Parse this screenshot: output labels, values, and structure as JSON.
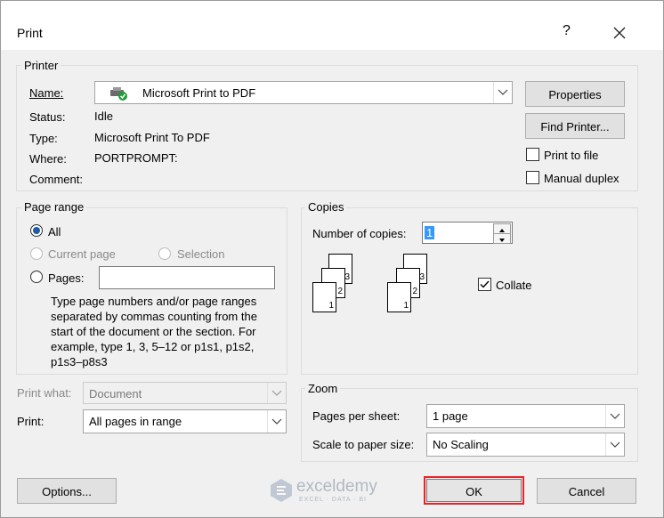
{
  "window": {
    "title": "Print",
    "help": "?",
    "close_icon": "close-icon"
  },
  "printer": {
    "legend": "Printer",
    "name_label": "Name:",
    "name_value": "Microsoft Print to PDF",
    "printer_icon": "printer-ready-icon",
    "status_label": "Status:",
    "status_value": "Idle",
    "type_label": "Type:",
    "type_value": "Microsoft Print To PDF",
    "where_label": "Where:",
    "where_value": "PORTPROMPT:",
    "comment_label": "Comment:",
    "comment_value": "",
    "properties_button": "Properties",
    "find_printer_button": "Find Printer...",
    "print_to_file_label": "Print to file",
    "print_to_file_checked": false,
    "manual_duplex_label": "Manual duplex",
    "manual_duplex_checked": false
  },
  "page_range": {
    "legend": "Page range",
    "all_label": "All",
    "current_page_label": "Current page",
    "selection_label": "Selection",
    "pages_label": "Pages:",
    "pages_value": "",
    "selected": "All",
    "help_text": [
      "Type page numbers and/or page ranges",
      "separated by commas counting from the",
      "start of the document or the section. For",
      "example, type 1, 3, 5–12 or p1s1, p1s2,",
      "p1s3–p8s3"
    ]
  },
  "copies": {
    "legend": "Copies",
    "number_label": "Number of copies:",
    "number_value": "1",
    "collate_label": "Collate",
    "collate_checked": true,
    "page_numbers": [
      "1",
      "2",
      "3"
    ]
  },
  "print_what": {
    "label": "Print what:",
    "value": "Document",
    "disabled": true
  },
  "print": {
    "label": "Print:",
    "value": "All pages in range"
  },
  "zoom": {
    "legend": "Zoom",
    "pages_per_sheet_label": "Pages per sheet:",
    "pages_per_sheet_value": "1 page",
    "scale_label": "Scale to paper size:",
    "scale_value": "No Scaling"
  },
  "buttons": {
    "options": "Options...",
    "ok": "OK",
    "cancel": "Cancel"
  },
  "watermark": {
    "brand": "exceldemy",
    "tagline": "EXCEL · DATA · BI"
  },
  "colors": {
    "highlight": "#e8232a",
    "radio_selected": "#1e5aa8",
    "copies_selection": "#3399ff"
  }
}
